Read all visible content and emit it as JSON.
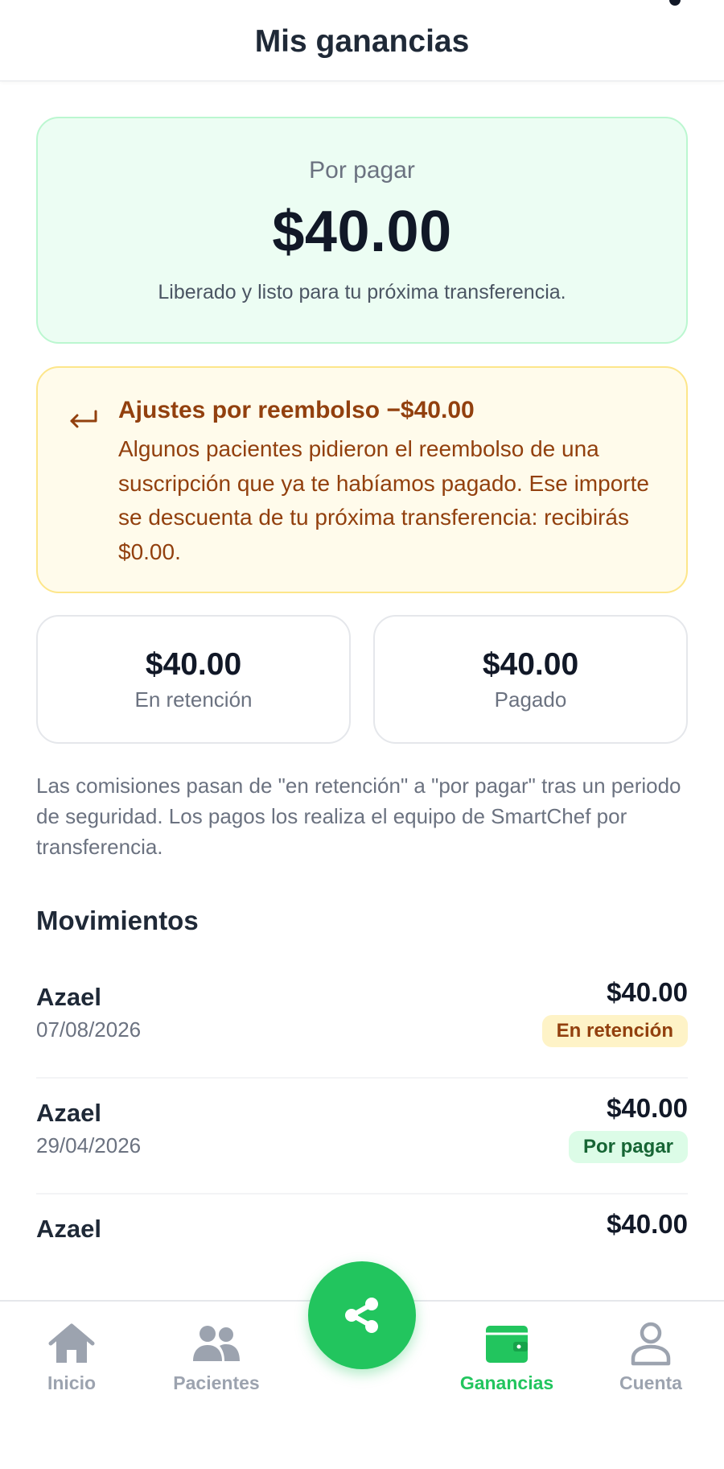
{
  "header": {
    "title": "Mis ganancias"
  },
  "summary": {
    "label": "Por pagar",
    "amount": "$40.00",
    "note": "Liberado y listo para tu próxima transferencia."
  },
  "refund_notice": {
    "icon": "return-arrow-icon",
    "title": "Ajustes por reembolso −$40.00",
    "body": "Algunos pacientes pidieron el reembolso de una suscripción que ya te habíamos pagado. Ese importe se descuenta de tu próxima transferencia: recibirás $0.00."
  },
  "stats": [
    {
      "value": "$40.00",
      "label": "En retención"
    },
    {
      "value": "$40.00",
      "label": "Pagado"
    }
  ],
  "info_text": "Las comisiones pasan de \"en retención\" a \"por pagar\" tras un periodo de seguridad. Los pagos los realiza el equipo de SmartChef por transferencia.",
  "movements": {
    "title": "Movimientos",
    "items": [
      {
        "name": "Azael",
        "date": "07/08/2026",
        "amount": "$40.00",
        "status": "En retención"
      },
      {
        "name": "Azael",
        "date": "29/04/2026",
        "amount": "$40.00",
        "status": "Por pagar"
      },
      {
        "name": "Azael",
        "date": "",
        "amount": "$40.00",
        "status": ""
      }
    ]
  },
  "nav": {
    "items": [
      {
        "label": "Inicio",
        "icon": "home-icon"
      },
      {
        "label": "Pacientes",
        "icon": "users-icon"
      },
      {
        "label": "Ganancias",
        "icon": "wallet-icon",
        "active": true
      },
      {
        "label": "Cuenta",
        "icon": "user-icon"
      }
    ],
    "fab_icon": "share-icon"
  },
  "colors": {
    "primary": "#22c55e",
    "nav_inactive": "#9ca3af",
    "warning_text": "#92400e",
    "badge_held_bg": "#fef3c7",
    "badge_held_text": "#92400e",
    "badge_due_bg": "#dcfce7",
    "badge_due_text": "#166534"
  }
}
